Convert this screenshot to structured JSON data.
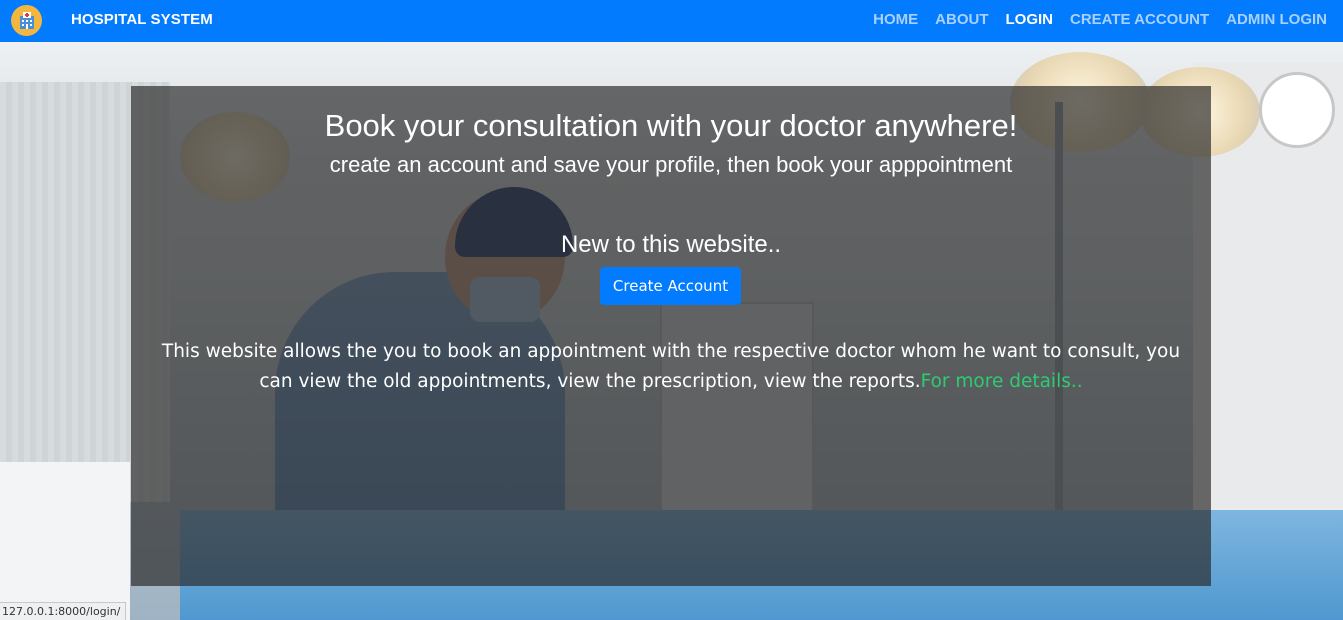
{
  "navbar": {
    "brand": "HOSPITAL SYSTEM",
    "logo_icon": "hospital-icon",
    "bg_color": "#027bff",
    "links": [
      {
        "label": "HOME",
        "active": false
      },
      {
        "label": "ABOUT",
        "active": false
      },
      {
        "label": "LOGIN",
        "active": true
      },
      {
        "label": "CREATE ACCOUNT",
        "active": false
      },
      {
        "label": "ADMIN LOGIN",
        "active": false
      }
    ]
  },
  "hero": {
    "headline": "Book your consultation with your doctor anywhere!",
    "subheadline": "create an account and save your profile, then book your apppointment",
    "new_prompt": "New to this website..",
    "create_button_label": "Create Account",
    "description": "This website allows the you to book an appointment with the respective doctor whom he want to consult, you can view the old appointments, view the prescription, view the reports.",
    "more_link": "For more details..",
    "link_color": "#2ecc71"
  },
  "status_bar": {
    "url": "127.0.0.1:8000/login/"
  }
}
